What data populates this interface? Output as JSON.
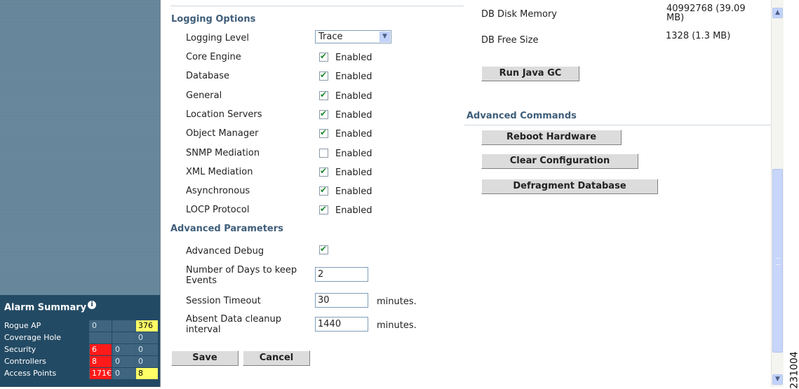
{
  "alarm_summary": {
    "title": "Alarm Summary",
    "rows": [
      {
        "label": "Rogue AP",
        "v1": "0",
        "v2": "",
        "v3": "376"
      },
      {
        "label": "Coverage Hole",
        "v1": "",
        "v2": "",
        "v3": "0"
      },
      {
        "label": "Security",
        "v1": "6",
        "v2": "0",
        "v3": "0"
      },
      {
        "label": "Controllers",
        "v1": "8",
        "v2": "0",
        "v3": "0"
      },
      {
        "label": "Access Points",
        "v1": "171€",
        "v2": "0",
        "v3": "8"
      }
    ]
  },
  "logging": {
    "title": "Logging Options",
    "level_label": "Logging Level",
    "level_value": "Trace",
    "enabled_text": "Enabled",
    "items": [
      {
        "label": "Core Engine",
        "checked": true
      },
      {
        "label": "Database",
        "checked": true
      },
      {
        "label": "General",
        "checked": true
      },
      {
        "label": "Location Servers",
        "checked": true
      },
      {
        "label": "Object Manager",
        "checked": true
      },
      {
        "label": "SNMP Mediation",
        "checked": false
      },
      {
        "label": "XML Mediation",
        "checked": true
      },
      {
        "label": "Asynchronous",
        "checked": true
      },
      {
        "label": "LOCP Protocol",
        "checked": true
      }
    ]
  },
  "advanced_params": {
    "title": "Advanced Parameters",
    "debug_label": "Advanced Debug",
    "days_label": "Number of Days to keep Events",
    "days_value": "2",
    "session_label": "Session Timeout",
    "session_value": "30",
    "cleanup_label": "Absent Data cleanup interval",
    "cleanup_value": "1440",
    "unit": "minutes."
  },
  "form_buttons": {
    "save": "Save",
    "cancel": "Cancel"
  },
  "db": {
    "disk_label": "DB Disk Memory",
    "disk_value_1": "40992768 (39.09",
    "disk_value_2": "MB)",
    "free_label": "DB Free Size",
    "free_value": "1328 (1.3 MB)",
    "gc_button": "Run Java GC"
  },
  "advanced_commands": {
    "title": "Advanced Commands",
    "reboot": "Reboot Hardware",
    "clear": "Clear Configuration",
    "defrag": "Defragment Database"
  },
  "figure_id": "231004",
  "colors": {
    "section_title": "#3f5e7a",
    "alarm_bg": "#234a64",
    "critical": "#ff1a1a",
    "minor": "#ffff66"
  }
}
